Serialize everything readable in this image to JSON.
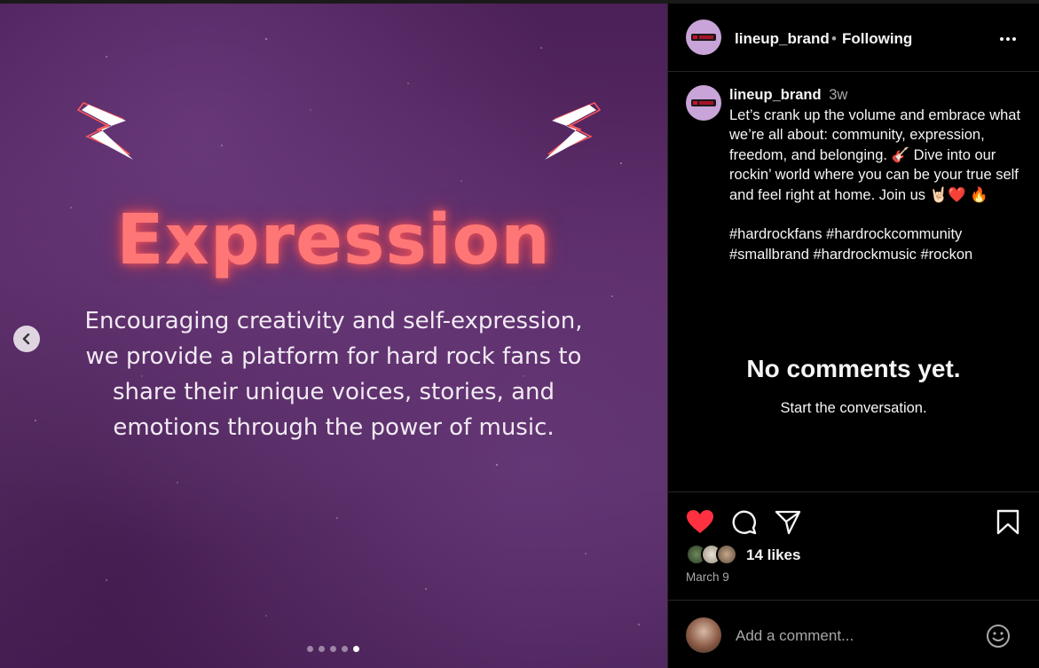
{
  "media": {
    "headline": "Expression",
    "body": "Encouraging creativity and self-expression, we provide a platform for hard rock fans to share their unique voices, stories, and emotions through the power of music.",
    "body_lines": [
      "Encouraging creativity and self-expression,",
      "we provide a platform for hard rock fans to",
      "share their unique voices, stories, and",
      "emotions through the power of music."
    ],
    "prev_icon": "chevron-left-icon",
    "slides_total": 5,
    "active_slide": 5
  },
  "header": {
    "username": "lineup_brand",
    "separator": "•",
    "follow_status": "Following",
    "more_icon": "more-horizontal-icon"
  },
  "caption": {
    "username": "lineup_brand",
    "time": "3w",
    "text": "Let’s crank up the volume and embrace what we’re all about: community, expression, freedom, and belonging. 🎸 Dive into our rockin’ world where you can be your true self and feel right at home. Join us 🤘🏻❤️ 🔥",
    "hashtags": "#hardrockfans #hardrockcommunity #smallbrand #hardrockmusic #rockon"
  },
  "comments": {
    "empty_title": "No comments yet.",
    "empty_subtitle": "Start the conversation."
  },
  "actions": {
    "like_icon": "heart-filled-icon",
    "comment_icon": "comment-icon",
    "share_icon": "send-icon",
    "save_icon": "bookmark-icon",
    "likes": "14 likes",
    "date": "March 9"
  },
  "composer": {
    "placeholder": "Add a comment...",
    "emoji_icon": "smiley-icon"
  },
  "colors": {
    "accent_like": "#ff3040",
    "headline": "#ff7676",
    "avatar_bg": "#c9a4d8"
  }
}
